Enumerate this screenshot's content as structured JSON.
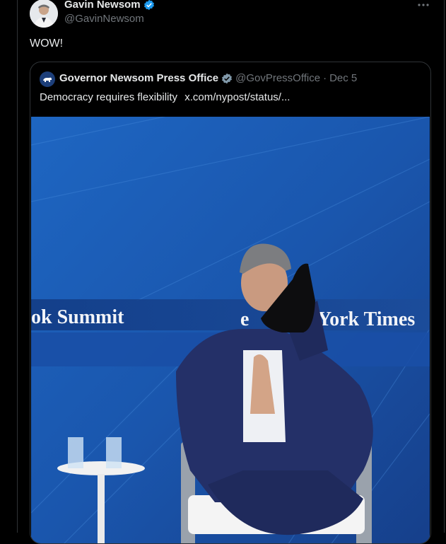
{
  "tweet": {
    "author_name": "Gavin Newsom",
    "author_handle": "@GavinNewsom",
    "text": "WOW!",
    "more_icon": "more-horizontal-icon",
    "verified_icon": "verified-badge-icon"
  },
  "quote": {
    "author_name": "Governor Newsom Press Office",
    "author_handle": "@GovPressOffice",
    "separator": "·",
    "date": "Dec 5",
    "text": "Democracy requires flexibility",
    "link": "x.com/nypost/status/...",
    "verified_icon": "verified-badge-gray-icon"
  },
  "media": {
    "banner_left": "ok Summit",
    "banner_right": "York Times",
    "banner_right_prefix": "e"
  },
  "colors": {
    "background": "#000000",
    "text_primary": "#e7e9ea",
    "text_secondary": "#71767b",
    "verified_blue": "#1d9bf0",
    "stage_blue": "#1c5fb8"
  }
}
